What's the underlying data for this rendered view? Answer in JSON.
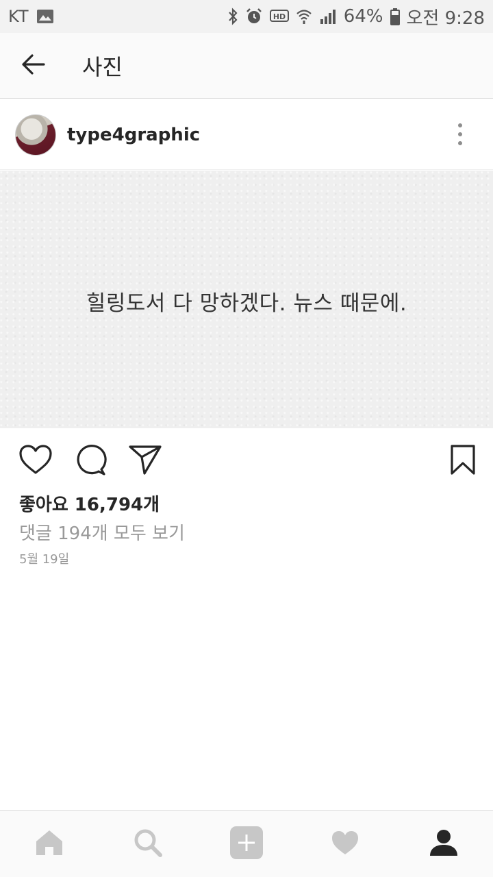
{
  "status_bar": {
    "carrier": "KT",
    "battery": "64%",
    "time": "오전 9:28",
    "icons": [
      "image-icon",
      "bluetooth-icon",
      "alarm-icon",
      "hd-icon",
      "wifi-icon",
      "signal-icon",
      "battery-icon"
    ]
  },
  "header": {
    "title": "사진",
    "back_icon": "back-arrow-icon"
  },
  "post": {
    "username": "type4graphic",
    "image_text": "힐링도서 다 망하겠다. 뉴스 때문에.",
    "likes": "좋아요 16,794개",
    "comments_link": "댓글 194개 모두 보기",
    "date": "5월 19일"
  },
  "actions": [
    "like-icon",
    "comment-icon",
    "share-icon",
    "bookmark-icon"
  ],
  "bottom_nav": [
    "home-icon",
    "search-icon",
    "add-icon",
    "activity-icon",
    "profile-icon"
  ],
  "colors": {
    "text": "#262626",
    "muted": "#999999",
    "nav_icon": "#c7c7c7",
    "active_icon": "#262626"
  }
}
